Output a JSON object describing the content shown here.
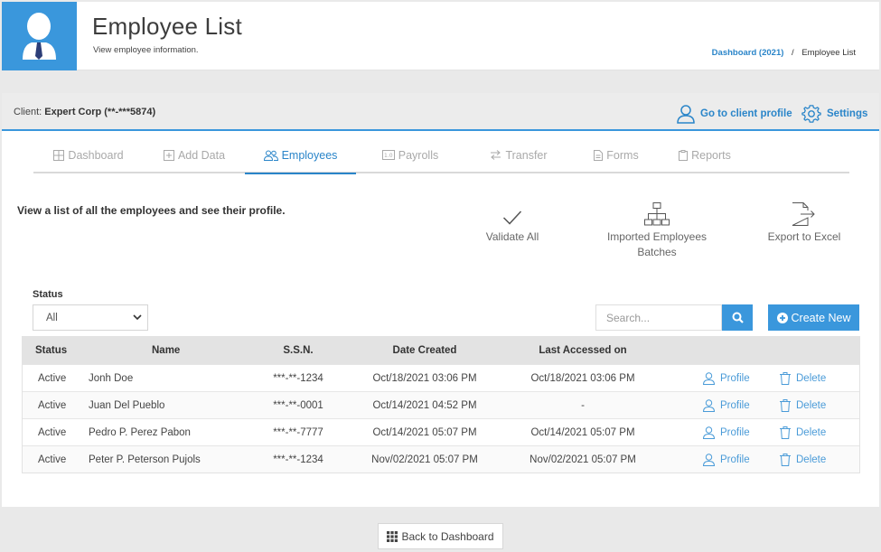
{
  "header": {
    "title": "Employee List",
    "subtitle": "View employee information.",
    "breadcrumb": {
      "link": "Dashboard (2021)",
      "separator": "/",
      "current": "Employee List"
    }
  },
  "client_bar": {
    "label_prefix": "Client:",
    "client_name": "Expert Corp (**-***5874)",
    "profile_link": "Go to client profile",
    "settings_link": "Settings"
  },
  "tabs": [
    {
      "label": "Dashboard",
      "icon": "grid-icon",
      "active": false
    },
    {
      "label": "Add Data",
      "icon": "plus-square-icon",
      "active": false
    },
    {
      "label": "Employees",
      "icon": "users-icon",
      "active": true
    },
    {
      "label": "Payrolls",
      "icon": "payroll-icon",
      "active": false
    },
    {
      "label": "Transfer",
      "icon": "transfer-icon",
      "active": false
    },
    {
      "label": "Forms",
      "icon": "document-icon",
      "active": false
    },
    {
      "label": "Reports",
      "icon": "clipboard-icon",
      "active": false
    }
  ],
  "intro": "View a list of all the employees and see their profile.",
  "actions": {
    "validate": "Validate All",
    "imported_line1": "Imported Employees",
    "imported_line2": "Batches",
    "export": "Export to Excel"
  },
  "filters": {
    "status_label": "Status",
    "status_value": "All",
    "search_placeholder": "Search...",
    "create_label": "Create New"
  },
  "table": {
    "columns": [
      "Status",
      "Name",
      "S.S.N.",
      "Date Created",
      "Last Accessed on"
    ],
    "profile_label": "Profile",
    "delete_label": "Delete",
    "rows": [
      {
        "status": "Active",
        "name": "Jonh Doe",
        "ssn": "***-**-1234",
        "created": "Oct/18/2021 03:06 PM",
        "last": "Oct/18/2021 03:06 PM"
      },
      {
        "status": "Active",
        "name": "Juan Del Pueblo",
        "ssn": "***-**-0001",
        "created": "Oct/14/2021 04:52 PM",
        "last": "-"
      },
      {
        "status": "Active",
        "name": "Pedro P. Perez Pabon",
        "ssn": "***-**-7777",
        "created": "Oct/14/2021 05:07 PM",
        "last": "Oct/14/2021 05:07 PM"
      },
      {
        "status": "Active",
        "name": "Peter P. Peterson Pujols",
        "ssn": "***-**-1234",
        "created": "Nov/02/2021 05:07 PM",
        "last": "Nov/02/2021 05:07 PM"
      }
    ]
  },
  "footer": {
    "back_label": "Back to Dashboard"
  },
  "colors": {
    "accent": "#3a97dc",
    "link": "#2a85c9"
  }
}
